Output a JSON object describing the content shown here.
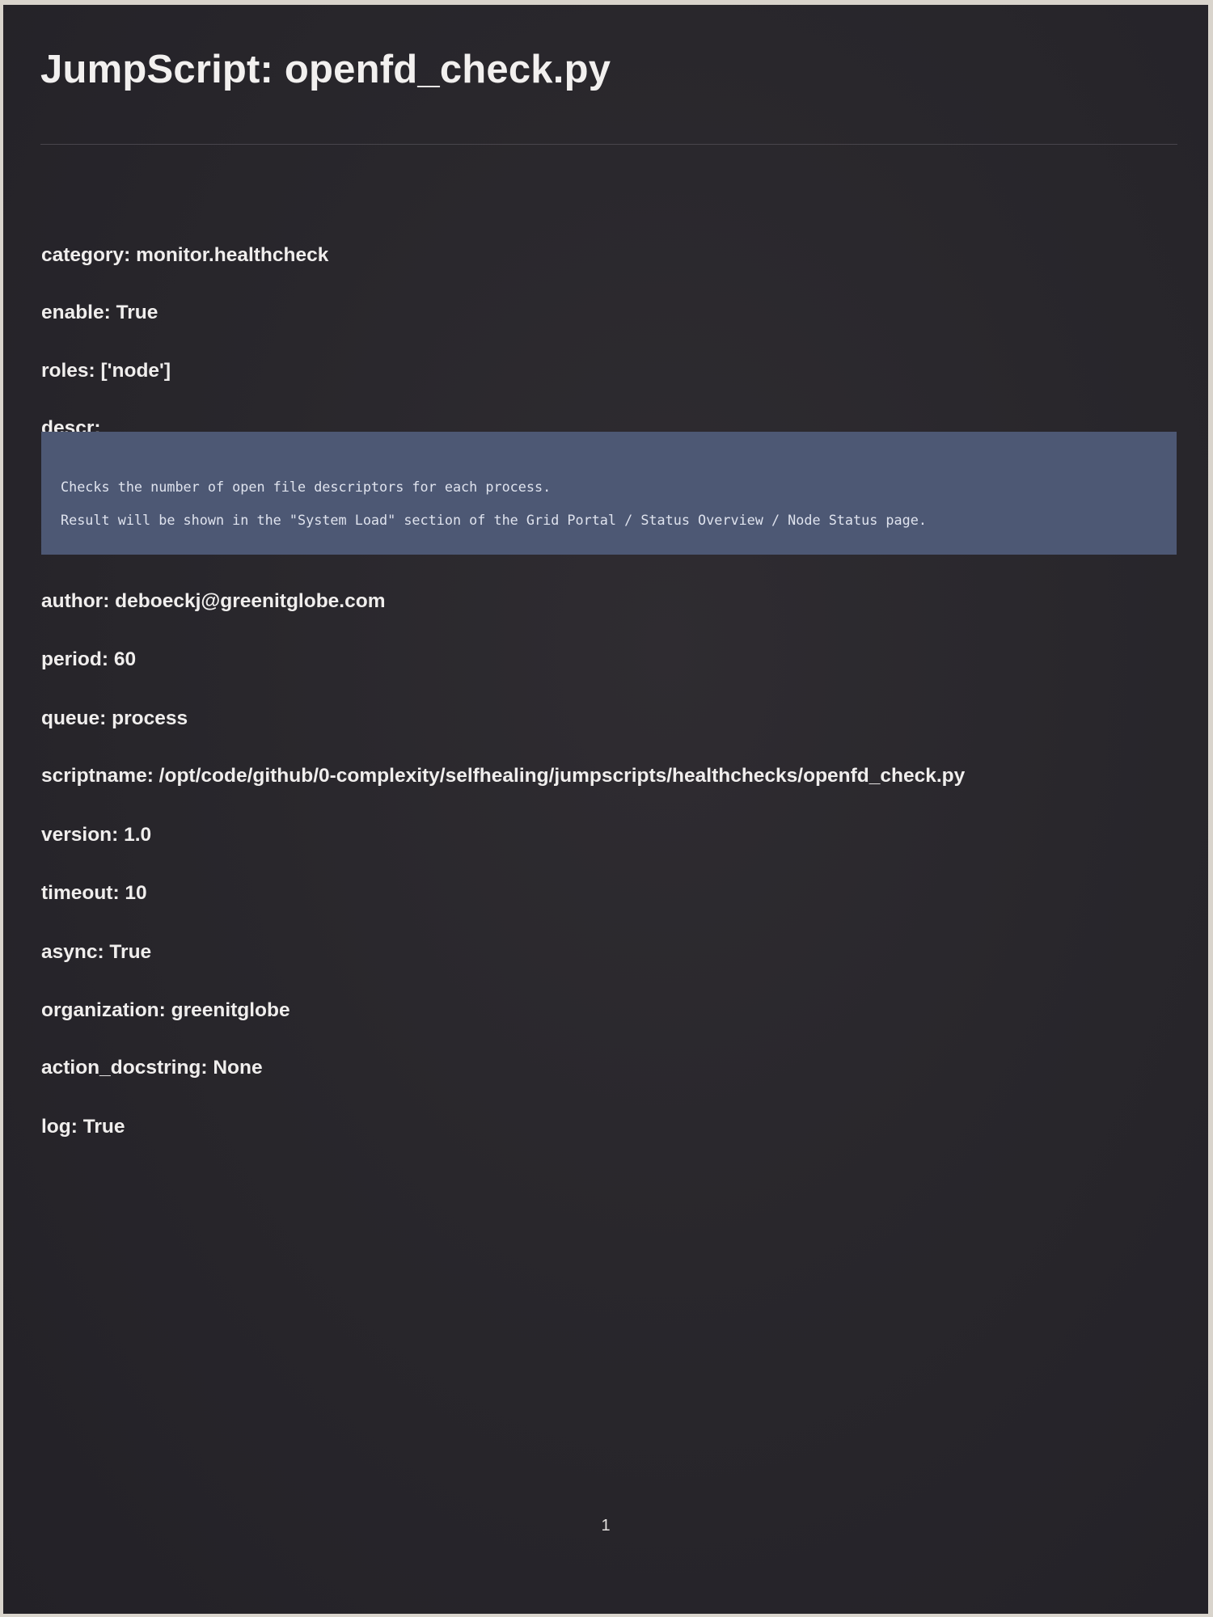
{
  "document": {
    "title": "JumpScript: openfd_check.py",
    "fields": [
      "category: monitor.healthcheck",
      "enable: True",
      "roles: ['node']",
      "descr:"
    ],
    "descr_lines": [
      "Checks the number of open file descriptors for each process.",
      "Result will be shown in the \"System Load\" section of the Grid Portal / Status Overview / Node Status page."
    ],
    "fields_after": [
      "author: deboeckj@greenitglobe.com",
      "period: 60",
      "queue: process",
      "scriptname: /opt/code/github/0-complexity/selfhealing/jumpscripts/healthchecks/openfd_check.py",
      "version: 1.0",
      "timeout: 10",
      "async: True",
      "organization: greenitglobe",
      "action_docstring: None",
      "log: True"
    ],
    "page_number": "1"
  }
}
